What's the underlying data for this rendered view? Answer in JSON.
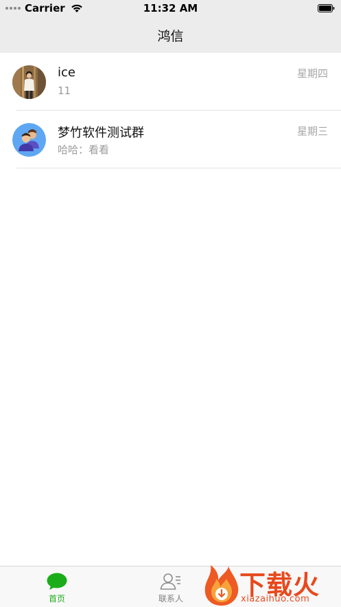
{
  "status_bar": {
    "carrier": "Carrier",
    "time": "11:32 AM"
  },
  "nav": {
    "title": "鸿信"
  },
  "chats": [
    {
      "name": "ice",
      "preview": "11",
      "time": "星期四",
      "avatar": "person-photo-avatar"
    },
    {
      "name": "梦竹软件测试群",
      "preview": "哈哈：看看",
      "time": "星期三",
      "avatar": "group-avatar"
    }
  ],
  "tabs": [
    {
      "label": "首页",
      "icon": "chat-bubble-icon",
      "active": true
    },
    {
      "label": "联系人",
      "icon": "contacts-icon",
      "active": false
    }
  ],
  "watermark": {
    "text": "下载火",
    "url": "xiazaihuo.com"
  },
  "colors": {
    "accent": "#1aad19",
    "bar_background": "#ececec",
    "muted_text": "#9a9a9a",
    "watermark": "#e8491d"
  }
}
